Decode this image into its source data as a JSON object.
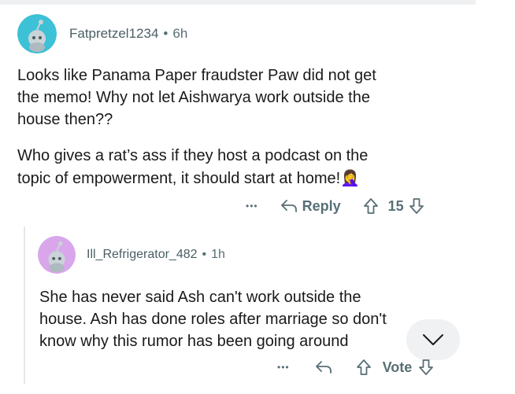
{
  "comment": {
    "author": "Fatpretzel1234",
    "separator": "•",
    "time": "6h",
    "paragraphs": [
      [
        "Looks like Panama Paper fraudster Paw did not get",
        "the memo! Why not let Aishwarya work outside the",
        "house then??"
      ],
      [
        "Who gives a rat’s ass if they host a podcast on the",
        "topic of empowerment, it should start at home!"
      ]
    ],
    "emoji": "🤦‍♀️",
    "more_label": "•••",
    "reply_label": "Reply",
    "vote_count": "15",
    "avatar_color": "#3cc1d6"
  },
  "reply": {
    "author": "Ill_Refrigerator_482",
    "separator": "•",
    "time": "1h",
    "lines": [
      "She has never said Ash can't work outside the",
      "house. Ash has done roles after marriage so don't",
      "know why this rumor has been going around"
    ],
    "more_label": "•••",
    "vote_label": "Vote",
    "avatar_color": "#d9a6ec"
  },
  "icons": {
    "more": "more-options-icon",
    "reply": "reply-arrow-icon",
    "upvote": "upvote-arrow-icon",
    "downvote": "downvote-arrow-icon",
    "collapse": "chevron-down-icon"
  }
}
